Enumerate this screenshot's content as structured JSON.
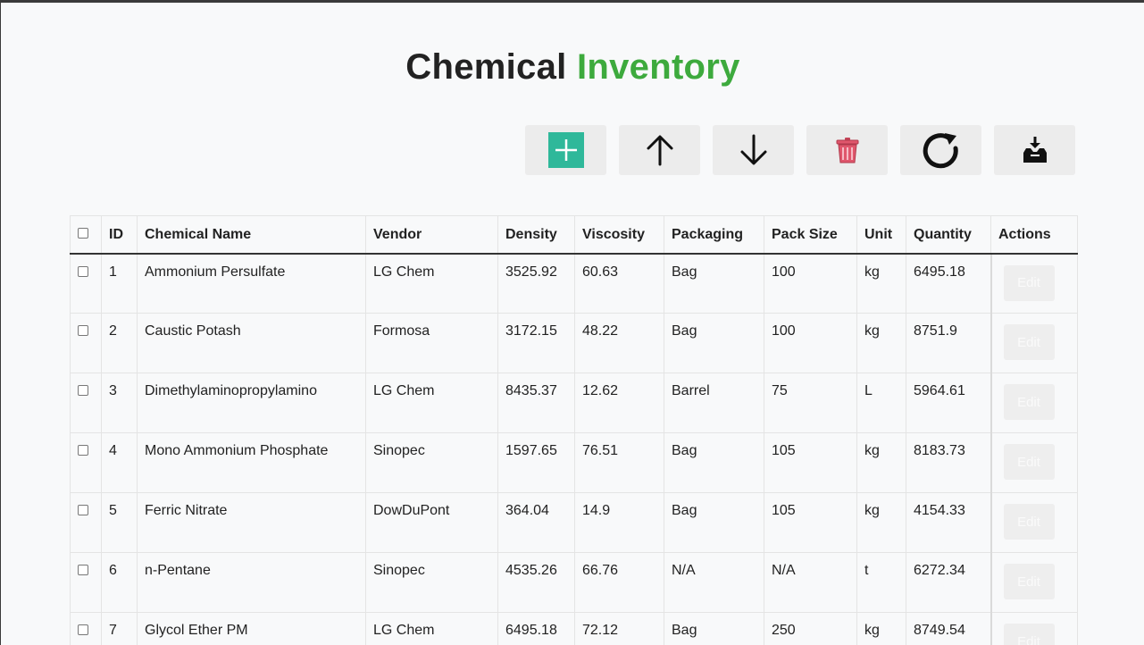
{
  "header": {
    "title_part1": "Chemical",
    "title_part2": "Inventory"
  },
  "toolbar": {
    "buttons": [
      {
        "icon": "plus-icon",
        "action": "add"
      },
      {
        "icon": "arrow-up-icon",
        "action": "move-up"
      },
      {
        "icon": "arrow-down-icon",
        "action": "move-down"
      },
      {
        "icon": "trash-icon",
        "action": "delete"
      },
      {
        "icon": "refresh-icon",
        "action": "refresh"
      },
      {
        "icon": "download-tray-icon",
        "action": "save"
      }
    ],
    "colors": {
      "add": "#2fb89a",
      "trash": "#e0566c"
    }
  },
  "table": {
    "columns": [
      "ID",
      "Chemical Name",
      "Vendor",
      "Density",
      "Viscosity",
      "Packaging",
      "Pack Size",
      "Unit",
      "Quantity",
      "Actions"
    ],
    "edit_label": "Edit",
    "rows": [
      [
        "1",
        "Ammonium Persulfate",
        "LG Chem",
        "3525.92",
        "60.63",
        "Bag",
        "100",
        "kg",
        "6495.18"
      ],
      [
        "2",
        "Caustic Potash",
        "Formosa",
        "3172.15",
        "48.22",
        "Bag",
        "100",
        "kg",
        "8751.9"
      ],
      [
        "3",
        "Dimethylaminopropylamino",
        "LG Chem",
        "8435.37",
        "12.62",
        "Barrel",
        "75",
        "L",
        "5964.61"
      ],
      [
        "4",
        "Mono Ammonium Phosphate",
        "Sinopec",
        "1597.65",
        "76.51",
        "Bag",
        "105",
        "kg",
        "8183.73"
      ],
      [
        "5",
        "Ferric Nitrate",
        "DowDuPont",
        "364.04",
        "14.9",
        "Bag",
        "105",
        "kg",
        "4154.33"
      ],
      [
        "6",
        "n-Pentane",
        "Sinopec",
        "4535.26",
        "66.76",
        "N/A",
        "N/A",
        "t",
        "6272.34"
      ],
      [
        "7",
        "Glycol Ether PM",
        "LG Chem",
        "6495.18",
        "72.12",
        "Bag",
        "250",
        "kg",
        "8749.54"
      ]
    ]
  }
}
